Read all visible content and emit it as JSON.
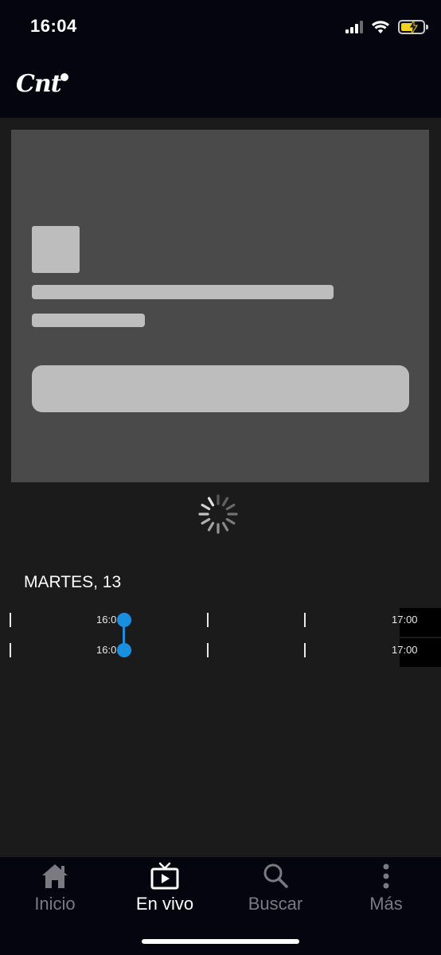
{
  "status_bar": {
    "time": "16:04",
    "icons": [
      "signal-icon",
      "wifi-icon",
      "battery-charging-icon"
    ]
  },
  "header": {
    "logo_text": "Cnt"
  },
  "loading": {
    "icon": "spinner-icon"
  },
  "schedule": {
    "day_label": "MARTES, 13",
    "rows": [
      {
        "start_time": "16:0",
        "end_time": "17:00"
      },
      {
        "start_time": "16:0",
        "end_time": "17:00"
      }
    ],
    "accent_color": "#1a8fe0"
  },
  "bottom_nav": {
    "items": [
      {
        "label": "Inicio",
        "icon": "home-icon",
        "active": false
      },
      {
        "label": "En vivo",
        "icon": "live-tv-icon",
        "active": true
      },
      {
        "label": "Buscar",
        "icon": "search-icon",
        "active": false
      },
      {
        "label": "Más",
        "icon": "more-vertical-icon",
        "active": false
      }
    ]
  }
}
